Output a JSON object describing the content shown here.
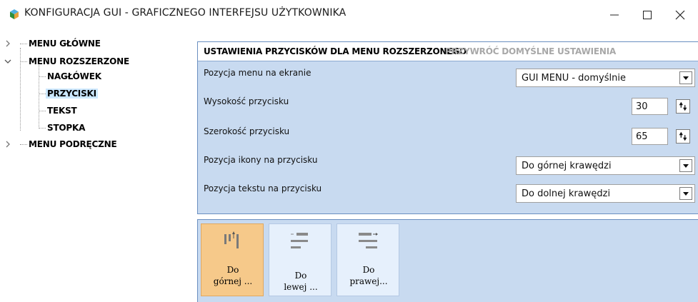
{
  "window": {
    "title": "KONFIGURACJA GUI - GRAFICZNEGO INTERFEJSU UŻYTKOWNIKA",
    "icon": "gui-config-app-icon",
    "controls": [
      "minimize-icon",
      "maximize-icon",
      "close-icon"
    ]
  },
  "tree": {
    "items": [
      {
        "label": "MENU GŁÓWNE",
        "expanded": false
      },
      {
        "label": "MENU ROZSZERZONE",
        "expanded": true
      },
      {
        "label": "NAGŁÓWEK"
      },
      {
        "label": "PRZYCISKI",
        "selected": true
      },
      {
        "label": "TEKST"
      },
      {
        "label": "STOPKA"
      },
      {
        "label": "MENU PODRĘCZNE",
        "expanded": false
      }
    ]
  },
  "panel": {
    "title": "USTAWIENIA PRZYCISKÓW DLA MENU ROZSZERZONEGO",
    "reset_label": "PRZYWRÓĆ DOMYŚLNE USTAWIENIA",
    "rows": [
      {
        "label": "Pozycja menu na ekranie",
        "control": "select",
        "value": "GUI MENU - domyślnie"
      },
      {
        "label": "Wysokość przycisku",
        "control": "spinner",
        "value": "30"
      },
      {
        "label": "Szerokość przycisku",
        "control": "spinner",
        "value": "65"
      },
      {
        "label": "Pozycja ikony na przycisku",
        "control": "select",
        "value": "Do górnej krawędzi"
      },
      {
        "label": "Pozycja tekstu na przycisku",
        "control": "select",
        "value": "Do dolnej krawędzi"
      }
    ]
  },
  "align_buttons": [
    {
      "line1": "Do",
      "line2": "górnej ...",
      "icon": "align-top-icon",
      "active": true
    },
    {
      "line1": "Do",
      "line2": "lewej ...",
      "icon": "align-left-icon",
      "active": false
    },
    {
      "line1": "Do",
      "line2": "prawej...",
      "icon": "align-right-icon",
      "active": false
    }
  ],
  "colors": {
    "panel_bg": "#c8daf0",
    "active_button": "#f6c98a",
    "selected_tree_item": "#cce8ff",
    "reset_link": "#a8a8a8"
  }
}
